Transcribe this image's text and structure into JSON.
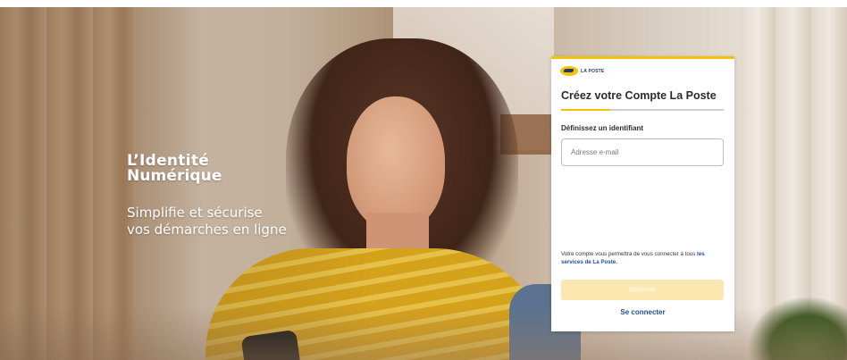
{
  "hero": {
    "brand_line1": "L’Identité",
    "brand_line2": "Numérique",
    "tagline_line1": "Simplifie et sécurise",
    "tagline_line2": "vos démarches en ligne"
  },
  "card": {
    "logo_text": "LA POSTE",
    "title": "Créez votre Compte La Poste",
    "progress_percent": 30,
    "field_label": "Définissez un identifiant",
    "email_placeholder": "Adresse e-mail",
    "info_text": "Votre compte vous permettra de vous connecter à tous ",
    "info_link": "les services de La Poste.",
    "continue_label": "Continuer",
    "login_label": "Se connecter"
  },
  "colors": {
    "accent": "#f3c300",
    "link": "#1f4e96",
    "button_disabled": "#fde7b0"
  }
}
